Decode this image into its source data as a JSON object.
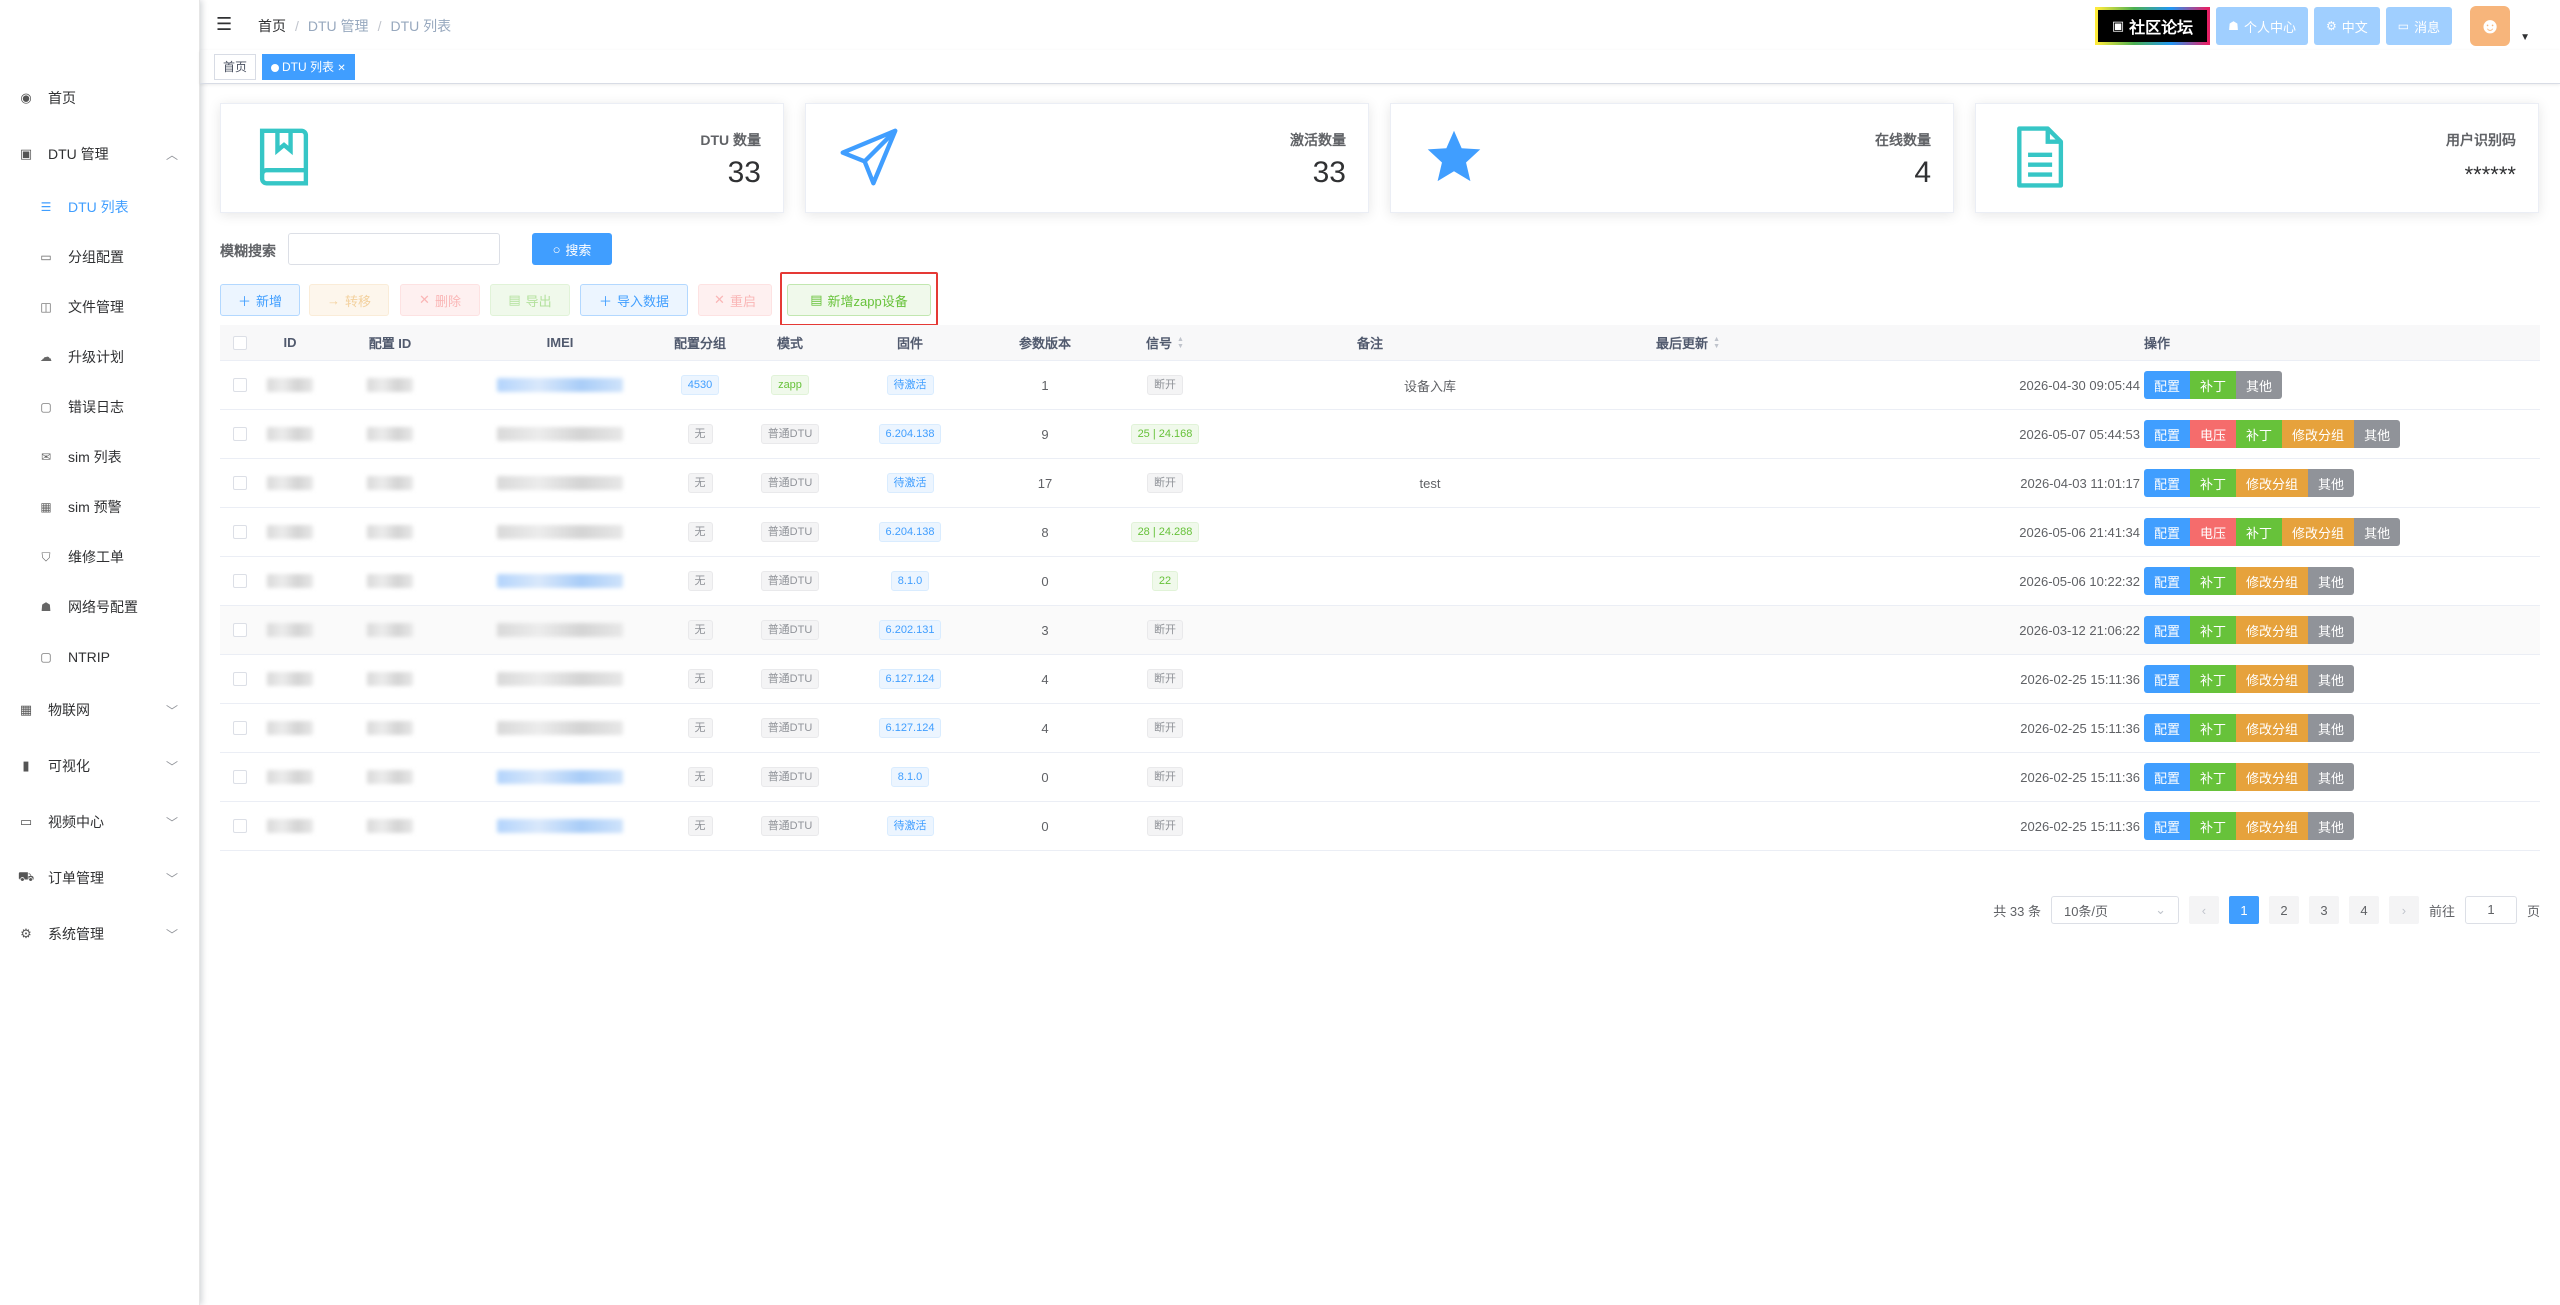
{
  "sidebar": {
    "items": [
      {
        "label": "首页",
        "icon": "dashboard-icon",
        "glyph": "◉"
      },
      {
        "label": "DTU 管理",
        "icon": "dtu-icon",
        "glyph": "▣",
        "expanded": true,
        "children": [
          {
            "label": "DTU 列表",
            "icon": "list-icon",
            "glyph": "☰",
            "active": true
          },
          {
            "label": "分组配置",
            "icon": "monitor-icon",
            "glyph": "▭"
          },
          {
            "label": "文件管理",
            "icon": "file-icon",
            "glyph": "◫"
          },
          {
            "label": "升级计划",
            "icon": "cloud-upload-icon",
            "glyph": "☁"
          },
          {
            "label": "错误日志",
            "icon": "log-icon",
            "glyph": "▢"
          },
          {
            "label": "sim 列表",
            "icon": "mail-icon",
            "glyph": "✉"
          },
          {
            "label": "sim 预警",
            "icon": "sim-icon",
            "glyph": "▦"
          },
          {
            "label": "维修工单",
            "icon": "shield-icon",
            "glyph": "⛉"
          },
          {
            "label": "网络号配置",
            "icon": "user-icon",
            "glyph": "☗"
          },
          {
            "label": "NTRIP",
            "icon": "ntrip-icon",
            "glyph": "▢"
          }
        ]
      },
      {
        "label": "物联网",
        "icon": "iot-icon",
        "glyph": "▦"
      },
      {
        "label": "可视化",
        "icon": "chart-icon",
        "glyph": "▮"
      },
      {
        "label": "视频中心",
        "icon": "video-icon",
        "glyph": "▭"
      },
      {
        "label": "订单管理",
        "icon": "cart-icon",
        "glyph": "⛟"
      },
      {
        "label": "系统管理",
        "icon": "gear-icon",
        "glyph": "⚙"
      }
    ]
  },
  "navbar": {
    "breadcrumb": [
      "首页",
      "DTU 管理",
      "DTU 列表"
    ],
    "forum": "社区论坛",
    "profile": "个人中心",
    "language": "中文",
    "messages": "消息"
  },
  "tags": {
    "home": "首页",
    "current": "DTU 列表"
  },
  "cards": [
    {
      "label": "DTU 数量",
      "value": "33",
      "icon": "book-icon"
    },
    {
      "label": "激活数量",
      "value": "33",
      "icon": "send-icon"
    },
    {
      "label": "在线数量",
      "value": "4",
      "icon": "star-icon"
    },
    {
      "label": "用户识别码",
      "value": "******",
      "icon": "document-icon"
    }
  ],
  "search": {
    "label": "模糊搜索",
    "value": "",
    "button": "搜索"
  },
  "toolbar": {
    "add": "新增",
    "transfer": "转移",
    "delete": "删除",
    "export": "导出",
    "import": "导入数据",
    "restart": "重启",
    "add_zapp": "新增zapp设备"
  },
  "table": {
    "headers": [
      "ID",
      "配置 ID",
      "IMEI",
      "配置分组",
      "模式",
      "固件",
      "参数版本",
      "信号",
      "备注",
      "最后更新",
      "操作"
    ],
    "rows": [
      {
        "group": "4530",
        "group_style": "blue",
        "mode": "zapp",
        "mode_style": "green",
        "firmware": "待激活",
        "param": "1",
        "signal": "断开",
        "signal_style": "gray",
        "note": "设备入库",
        "updated": "2026-04-30 09:05:44",
        "imei_blue": true,
        "ops": [
          "配置",
          "补丁",
          "其他"
        ]
      },
      {
        "group": "无",
        "group_style": "gray",
        "mode": "普通DTU",
        "mode_style": "gray",
        "firmware": "6.204.138",
        "param": "9",
        "signal": "25 | 24.168",
        "signal_style": "green",
        "note": "",
        "updated": "2026-05-07 05:44:53",
        "imei_blue": false,
        "ops": [
          "配置",
          "电压",
          "补丁",
          "修改分组",
          "其他"
        ]
      },
      {
        "group": "无",
        "group_style": "gray",
        "mode": "普通DTU",
        "mode_style": "gray",
        "firmware": "待激活",
        "param": "17",
        "signal": "断开",
        "signal_style": "gray",
        "note": "test",
        "updated": "2026-04-03 11:01:17",
        "imei_blue": false,
        "ops": [
          "配置",
          "补丁",
          "修改分组",
          "其他"
        ]
      },
      {
        "group": "无",
        "group_style": "gray",
        "mode": "普通DTU",
        "mode_style": "gray",
        "firmware": "6.204.138",
        "param": "8",
        "signal": "28 | 24.288",
        "signal_style": "green",
        "note": "",
        "updated": "2026-05-06 21:41:34",
        "imei_blue": false,
        "ops": [
          "配置",
          "电压",
          "补丁",
          "修改分组",
          "其他"
        ]
      },
      {
        "group": "无",
        "group_style": "gray",
        "mode": "普通DTU",
        "mode_style": "gray",
        "firmware": "8.1.0",
        "param": "0",
        "signal": "22",
        "signal_style": "green",
        "note": "",
        "updated": "2026-05-06 10:22:32",
        "imei_blue": true,
        "ops": [
          "配置",
          "补丁",
          "修改分组",
          "其他"
        ]
      },
      {
        "group": "无",
        "group_style": "gray",
        "mode": "普通DTU",
        "mode_style": "gray",
        "firmware": "6.202.131",
        "param": "3",
        "signal": "断开",
        "signal_style": "gray",
        "note": "",
        "updated": "2026-03-12 21:06:22",
        "imei_blue": false,
        "ops": [
          "配置",
          "补丁",
          "修改分组",
          "其他"
        ]
      },
      {
        "group": "无",
        "group_style": "gray",
        "mode": "普通DTU",
        "mode_style": "gray",
        "firmware": "6.127.124",
        "param": "4",
        "signal": "断开",
        "signal_style": "gray",
        "note": "",
        "updated": "2026-02-25 15:11:36",
        "imei_blue": false,
        "ops": [
          "配置",
          "补丁",
          "修改分组",
          "其他"
        ]
      },
      {
        "group": "无",
        "group_style": "gray",
        "mode": "普通DTU",
        "mode_style": "gray",
        "firmware": "6.127.124",
        "param": "4",
        "signal": "断开",
        "signal_style": "gray",
        "note": "",
        "updated": "2026-02-25 15:11:36",
        "imei_blue": false,
        "ops": [
          "配置",
          "补丁",
          "修改分组",
          "其他"
        ]
      },
      {
        "group": "无",
        "group_style": "gray",
        "mode": "普通DTU",
        "mode_style": "gray",
        "firmware": "8.1.0",
        "param": "0",
        "signal": "断开",
        "signal_style": "gray",
        "note": "",
        "updated": "2026-02-25 15:11:36",
        "imei_blue": true,
        "ops": [
          "配置",
          "补丁",
          "修改分组",
          "其他"
        ]
      },
      {
        "group": "无",
        "group_style": "gray",
        "mode": "普通DTU",
        "mode_style": "gray",
        "firmware": "待激活",
        "param": "0",
        "signal": "断开",
        "signal_style": "gray",
        "note": "",
        "updated": "2026-02-25 15:11:36",
        "imei_blue": true,
        "ops": [
          "配置",
          "补丁",
          "修改分组",
          "其他"
        ]
      }
    ]
  },
  "op_colors": {
    "配置": "blue",
    "电压": "red",
    "补丁": "green",
    "修改分组": "orange",
    "其他": "gray"
  },
  "pagination": {
    "total": "共 33 条",
    "page_size": "10条/页",
    "pages": [
      "1",
      "2",
      "3",
      "4"
    ],
    "current": "1",
    "goto_label": "前往",
    "goto_value": "1",
    "page_suffix": "页"
  },
  "colors": {
    "primary": "#409eff",
    "icon_teal": "#36c6c6",
    "icon_blue": "#409eff",
    "highlight": "#e53935"
  }
}
